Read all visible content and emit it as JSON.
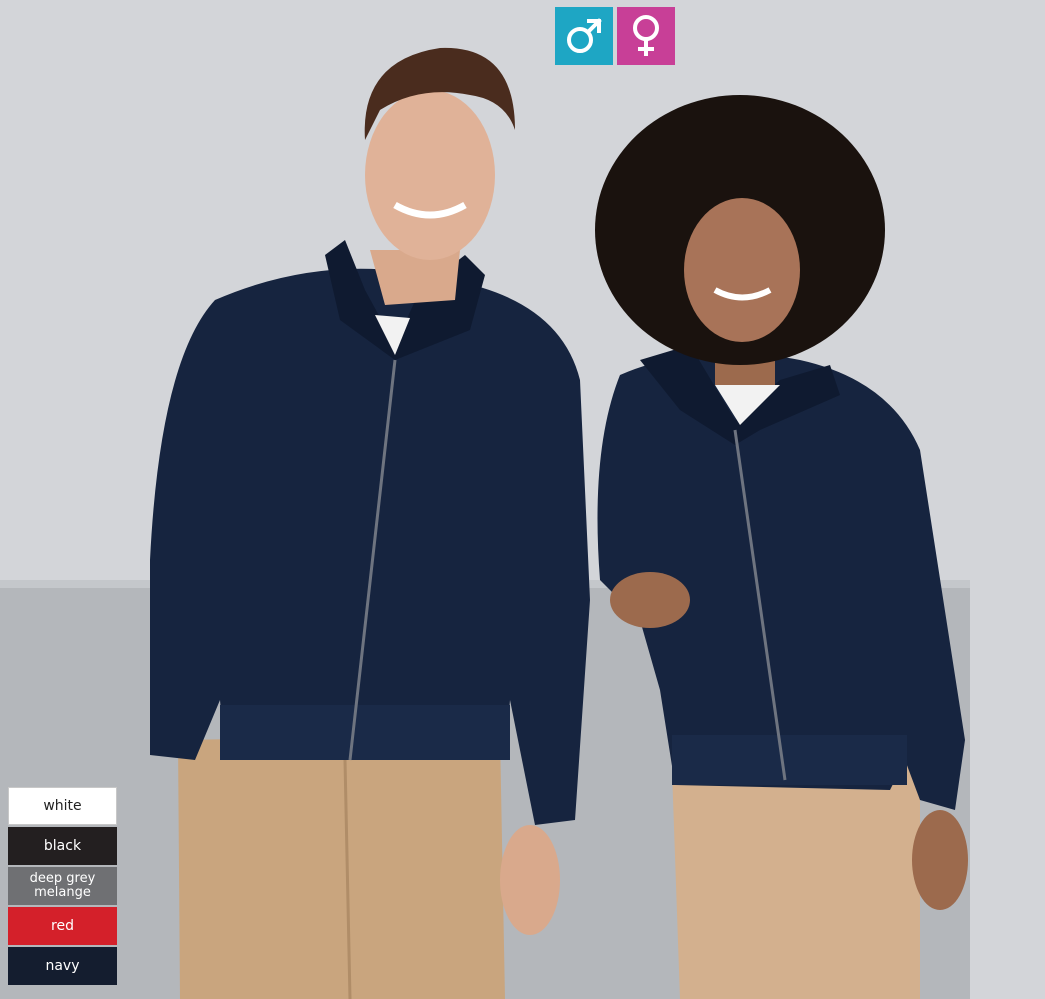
{
  "gender_selector": {
    "male_icon": "male-symbol-icon",
    "female_icon": "female-symbol-icon",
    "male_color": "#1ea6c4",
    "female_color": "#c83f97"
  },
  "product_photo": {
    "subject_icon": "product-photo"
  },
  "color_swatches": [
    {
      "label": "white",
      "color": "#ffffff"
    },
    {
      "label": "black",
      "color": "#231f20"
    },
    {
      "label": "deep grey melange",
      "color": "#6f7073"
    },
    {
      "label": "red",
      "color": "#d4202a"
    },
    {
      "label": "navy",
      "color": "#141d2f"
    }
  ]
}
